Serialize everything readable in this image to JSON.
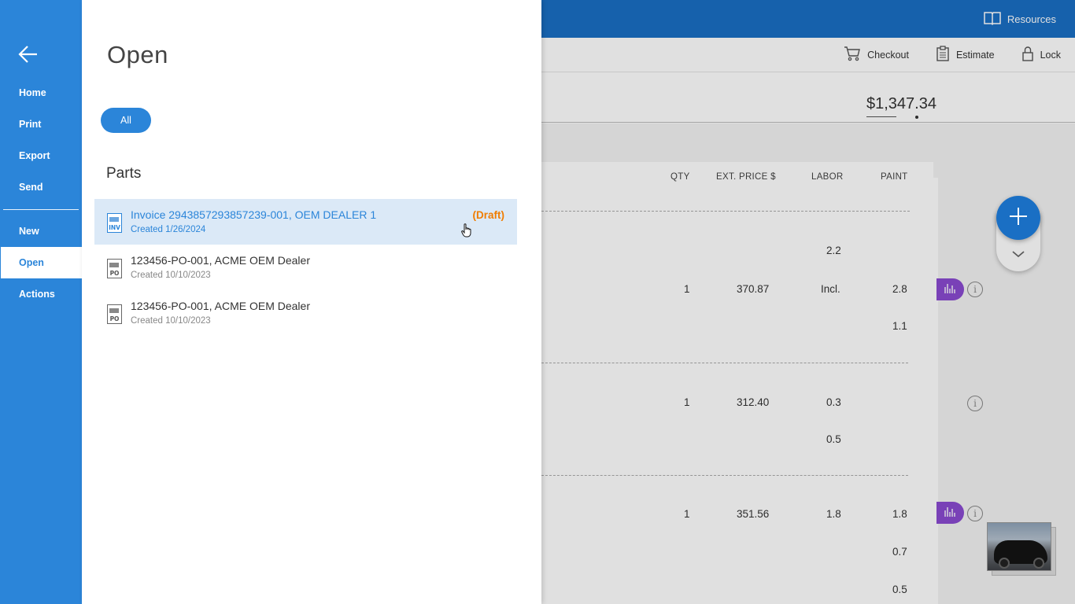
{
  "background": {
    "resources_label": "Resources",
    "toolbar": {
      "checkout": "Checkout",
      "estimate": "Estimate",
      "lock": "Lock"
    },
    "total": "$1,347.34",
    "columns": [
      "QTY",
      "EXT. PRICE $",
      "LABOR",
      "PAINT"
    ],
    "rows": [
      {
        "qty": "",
        "price": "",
        "labor": "2.2",
        "paint": ""
      },
      {
        "qty": "1",
        "price": "370.87",
        "labor": "Incl.",
        "paint": "2.8"
      },
      {
        "qty": "",
        "price": "",
        "labor": "",
        "paint": "1.1"
      },
      {
        "qty": "1",
        "price": "312.40",
        "labor": "0.3",
        "paint": ""
      },
      {
        "qty": "",
        "price": "",
        "labor": "0.5",
        "paint": ""
      },
      {
        "qty": "1",
        "price": "351.56",
        "labor": "1.8",
        "paint": "1.8"
      },
      {
        "qty": "",
        "price": "",
        "labor": "",
        "paint": "0.7"
      },
      {
        "qty": "",
        "price": "",
        "labor": "",
        "paint": "0.5"
      }
    ],
    "info_glyph": "i"
  },
  "nav": {
    "items": [
      {
        "label": "Home"
      },
      {
        "label": "Print"
      },
      {
        "label": "Export"
      },
      {
        "label": "Send"
      },
      {
        "label": "New"
      },
      {
        "label": "Open"
      },
      {
        "label": "Actions"
      }
    ],
    "active": "Open"
  },
  "panel": {
    "title": "Open",
    "filter_label": "All",
    "section_title": "Parts",
    "documents": [
      {
        "icon_label": "INV",
        "title": "Invoice 2943857293857239-001, OEM DEALER 1",
        "created": "Created 1/26/2024",
        "status": "(Draft)",
        "selected": true
      },
      {
        "icon_label": "PO",
        "title": "123456-PO-001, ACME OEM Dealer",
        "created": "Created 10/10/2023",
        "status": "",
        "selected": false
      },
      {
        "icon_label": "PO",
        "title": "123456-PO-001, ACME OEM Dealer",
        "created": "Created 10/10/2023",
        "status": "",
        "selected": false
      }
    ]
  },
  "colors": {
    "brand_blue": "#2b85d9",
    "topbar_blue": "#1a6fc4",
    "draft_orange": "#f07d00",
    "accent_purple": "#8a4bd1"
  }
}
